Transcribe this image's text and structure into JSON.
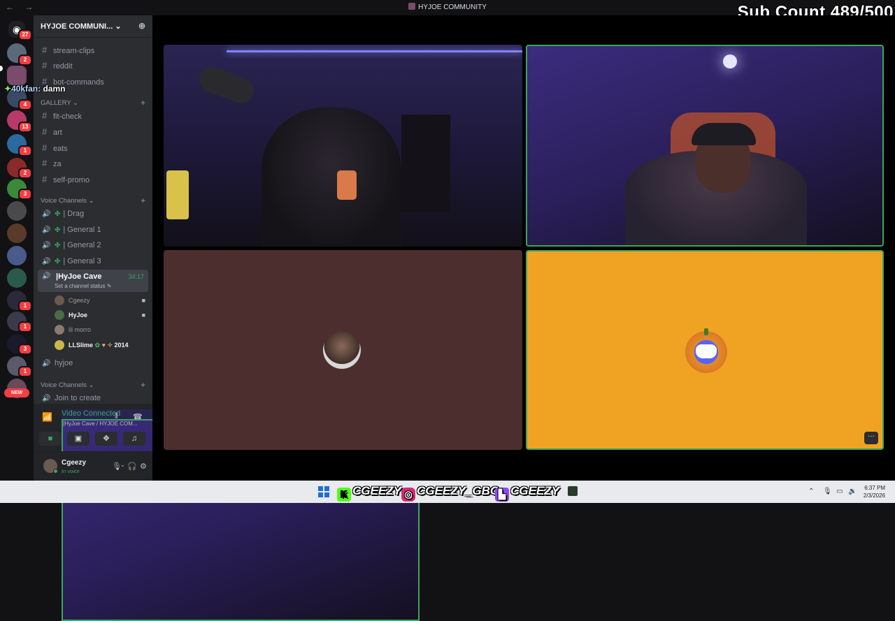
{
  "window": {
    "title": "HYJOE COMMUNITY",
    "nav_back": "←",
    "nav_forward": "→"
  },
  "overlay": {
    "sub_count": "Sub Count 489/500",
    "chat_user": "40kfan:",
    "chat_message": "damn",
    "chat_star": "✦"
  },
  "rail": {
    "home_badge": "27",
    "badges": [
      "2",
      "4",
      "13",
      "1",
      "2",
      "3",
      "1",
      "1",
      "3",
      "1"
    ],
    "new_label": "NEW"
  },
  "server": {
    "name": "HYJOE COMMUNI...",
    "add_icon": "+"
  },
  "channels": {
    "stream_clips": "stream-clips",
    "reddit": "reddit",
    "bot_commands": "bot-commands",
    "gallery_category": "GALLERY",
    "fit_check": "fit-check",
    "art": "art",
    "eats": "eats",
    "za": "za",
    "self_promo": "self-promo",
    "voice_category": "Voice Channels",
    "drag": "| Drag",
    "general1": "| General 1",
    "general2": "| General 2",
    "general3": "| General 3",
    "active_name": "|HyJoe Cave",
    "active_time": "34:17",
    "active_status": "Set a channel status",
    "members": [
      "Cgeezy",
      "HyJoe",
      "lil morro",
      "LLSlime"
    ],
    "llslime_tag": "2014",
    "hyjoe": "hyjoe",
    "voice_category2": "Voice Channels",
    "join_to_create": "Join to create"
  },
  "voice": {
    "connected": "Video Connected",
    "location": "|HyJoe Cave / HYJOE COM..."
  },
  "user": {
    "name": "Cgeezy",
    "status": "In voice"
  },
  "taskbar": {
    "kick": "CGEEZY",
    "instagram": "CGEEZY_GBC",
    "twitch": "CGEEZY",
    "time": "6:37 PM",
    "date": "2/3/2026"
  },
  "colors": {
    "accent_green": "#3ba55d",
    "tile_orange": "#f0a323",
    "tile_brown": "#4d2e2f",
    "badge_red": "#f23f43"
  }
}
